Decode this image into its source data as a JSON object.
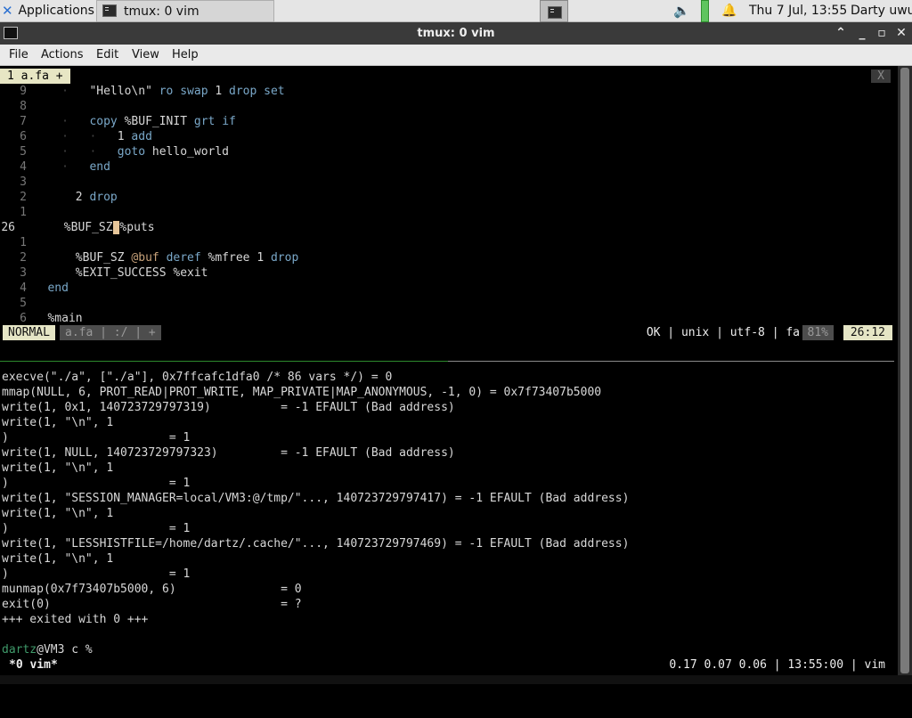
{
  "panel": {
    "apps_label": "Applications",
    "task_title": "tmux: 0 vim",
    "clock": "Thu  7 Jul, 13:55",
    "user": "Darty uwu"
  },
  "window": {
    "title": "tmux: 0 vim",
    "menu": [
      "File",
      "Actions",
      "Edit",
      "View",
      "Help"
    ]
  },
  "vim": {
    "tab_label": "1 a.fa +",
    "tab_close": "X",
    "lines": [
      {
        "n": "9",
        "dots": "  ·   ",
        "code": "\"Hello\\n\" ro swap 1 drop set"
      },
      {
        "n": "8",
        "dots": "",
        "code": ""
      },
      {
        "n": "7",
        "dots": "  ·   ",
        "code": "copy %BUF_INIT grt if"
      },
      {
        "n": "6",
        "dots": "  ·   ·   ",
        "code": "1 add"
      },
      {
        "n": "5",
        "dots": "  ·   ·   ",
        "code": "goto hello_world"
      },
      {
        "n": "4",
        "dots": "  ·   ",
        "code": "end"
      },
      {
        "n": "3",
        "dots": "",
        "code": ""
      },
      {
        "n": "2",
        "dots": "    ",
        "code": "2 drop"
      },
      {
        "n": "1",
        "dots": "",
        "code": ""
      },
      {
        "n": "26",
        "dots": "    ",
        "code": "%BUF_SZ %puts"
      },
      {
        "n": "1",
        "dots": "",
        "code": ""
      },
      {
        "n": "2",
        "dots": "    ",
        "code": "%BUF_SZ @buf deref %mfree 1 drop"
      },
      {
        "n": "3",
        "dots": "    ",
        "code": "%EXIT_SUCCESS %exit"
      },
      {
        "n": "4",
        "dots": "",
        "code": "end"
      },
      {
        "n": "5",
        "dots": "",
        "code": ""
      },
      {
        "n": "6",
        "dots": "",
        "code": "%main"
      }
    ],
    "status": {
      "mode": "NORMAL",
      "file": "a.fa | :/ | +",
      "right": "OK | unix | utf-8 | fa",
      "percent": "81%",
      "position": "26:12"
    }
  },
  "strace_output": [
    "execve(\"./a\", [\"./a\"], 0x7ffcafc1dfa0 /* 86 vars */) = 0",
    "mmap(NULL, 6, PROT_READ|PROT_WRITE, MAP_PRIVATE|MAP_ANONYMOUS, -1, 0) = 0x7f73407b5000",
    "write(1, 0x1, 140723729797319)          = -1 EFAULT (Bad address)",
    "write(1, \"\\n\", 1",
    ")                       = 1",
    "write(1, NULL, 140723729797323)         = -1 EFAULT (Bad address)",
    "write(1, \"\\n\", 1",
    ")                       = 1",
    "write(1, \"SESSION_MANAGER=local/VM3:@/tmp/\"..., 140723729797417) = -1 EFAULT (Bad address)",
    "write(1, \"\\n\", 1",
    ")                       = 1",
    "write(1, \"LESSHISTFILE=/home/dartz/.cache/\"..., 140723729797469) = -1 EFAULT (Bad address)",
    "write(1, \"\\n\", 1",
    ")                       = 1",
    "munmap(0x7f73407b5000, 6)               = 0",
    "exit(0)                                 = ?",
    "+++ exited with 0 +++"
  ],
  "shell": {
    "prompt_user": "dartz",
    "prompt_rest": "@VM3 c % "
  },
  "tmux": {
    "window_label": "*0 vim*",
    "status_right": "0.17 0.07 0.06 | 13:55:00 | vim"
  }
}
